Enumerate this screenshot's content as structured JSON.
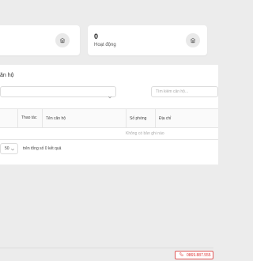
{
  "stats": [
    {
      "value": "",
      "label": ""
    },
    {
      "value": "0",
      "label": "Hoạt động"
    }
  ],
  "section": {
    "title": "ăn hộ"
  },
  "filters": {
    "search_placeholder": "Tìm kiếm căn hộ..."
  },
  "table": {
    "columns": [
      "Thao tác",
      "Tên căn hộ",
      "Số phòng",
      "Địa chỉ"
    ],
    "empty_message": "Không có bản ghi nào"
  },
  "pagination": {
    "page_size": "50",
    "total_text": "trên tổng số 0 kết quả"
  },
  "hotline": {
    "phone": "0869.887.555"
  },
  "colors": {
    "hotline": "#d33333",
    "background": "#ececec"
  },
  "icons": [
    "home-icon",
    "chevron-down-icon",
    "phone-icon"
  ]
}
